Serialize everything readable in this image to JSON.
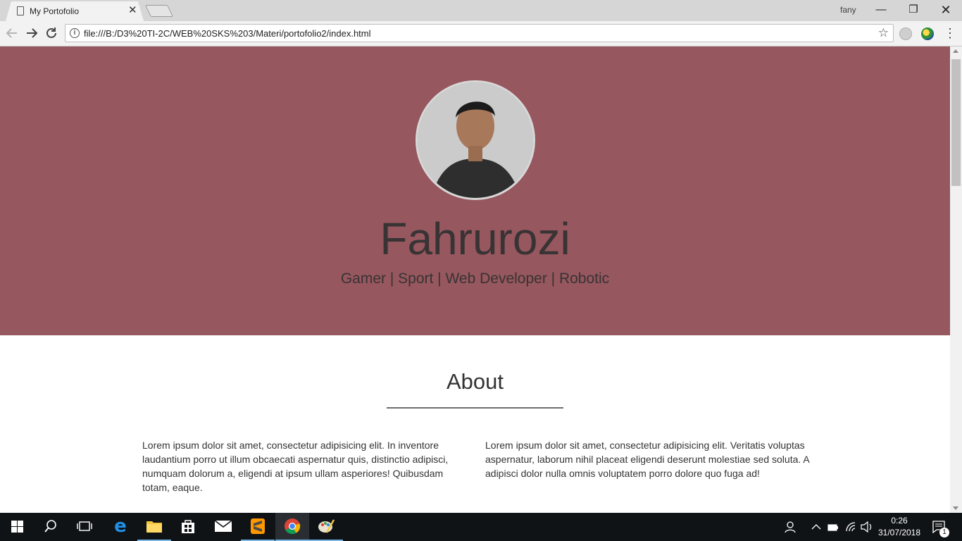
{
  "browser": {
    "tab_title": "My Portofolio",
    "tab_close": "✕",
    "user": "fany",
    "url": "file:///B:/D3%20TI-2C/WEB%20SKS%203/Materi/portofolio2/index.html",
    "controls": {
      "minimize": "—",
      "restore": "❐",
      "close": "✕"
    }
  },
  "hero": {
    "name": "Fahrurozi",
    "tagline": "Gamer | Sport | Web Developer | Robotic",
    "background": "#96575e"
  },
  "about": {
    "title": "About",
    "left": "Lorem ipsum dolor sit amet, consectetur adipisicing elit. In inventore laudantium porro ut illum obcaecati aspernatur quis, distinctio adipisci, numquam dolorum a, eligendi at ipsum ullam asperiores! Quibusdam totam, eaque.",
    "right": "Lorem ipsum dolor sit amet, consectetur adipisicing elit. Veritatis voluptas aspernatur, laborum nihil placeat eligendi deserunt molestiae sed soluta. A adipisci dolor nulla omnis voluptatem porro dolore quo fuga ad!"
  },
  "taskbar": {
    "time": "0:26",
    "date": "31/07/2018",
    "notification_count": "1",
    "apps": [
      "start-icon",
      "search-icon",
      "task-view-icon",
      "edge-icon",
      "file-explorer-icon",
      "store-icon",
      "mail-icon",
      "sublime-text-icon",
      "chrome-icon",
      "paint-icon"
    ]
  }
}
